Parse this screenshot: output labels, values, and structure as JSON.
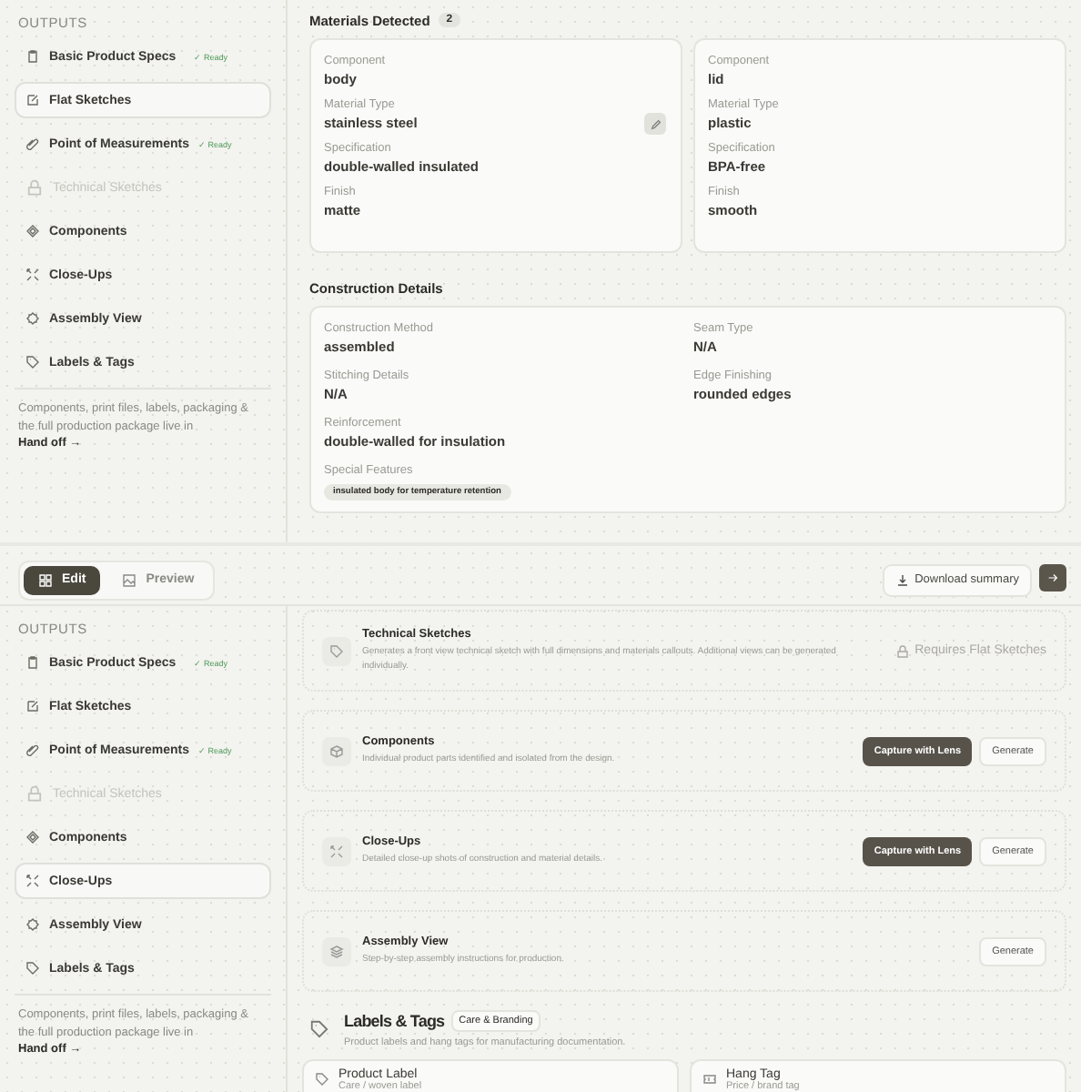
{
  "top_view": {
    "sidebar": {
      "heading": "OUTPUTS",
      "items": [
        {
          "label": "Basic Product Specs",
          "badge": "✓ Ready",
          "selected": false,
          "disabled": false
        },
        {
          "label": "Flat Sketches",
          "selected": true,
          "disabled": false
        },
        {
          "label": "Point of Measurements",
          "badge": "✓ Ready",
          "selected": false,
          "disabled": false
        },
        {
          "label": "Technical Sketches",
          "selected": false,
          "disabled": true
        },
        {
          "label": "Components",
          "selected": false,
          "disabled": false
        },
        {
          "label": "Close-Ups",
          "selected": false,
          "disabled": false
        },
        {
          "label": "Assembly View",
          "selected": false,
          "disabled": false
        },
        {
          "label": "Labels & Tags",
          "selected": false,
          "disabled": false
        }
      ],
      "note": "Components, print files, labels, packaging & the full production package live in",
      "link": "Hand off →"
    },
    "materials": {
      "title": "Materials Detected",
      "count": "2",
      "cards": [
        {
          "editable": true,
          "fields": [
            {
              "label": "Component",
              "value": "body"
            },
            {
              "label": "Material Type",
              "value": "stainless steel"
            },
            {
              "label": "Specification",
              "value": "double-walled insulated"
            },
            {
              "label": "Finish",
              "value": "matte"
            }
          ]
        },
        {
          "editable": false,
          "fields": [
            {
              "label": "Component",
              "value": "lid"
            },
            {
              "label": "Material Type",
              "value": "plastic"
            },
            {
              "label": "Specification",
              "value": "BPA-free"
            },
            {
              "label": "Finish",
              "value": "smooth"
            }
          ]
        }
      ]
    },
    "construction": {
      "title": "Construction Details",
      "fields": [
        {
          "label": "Construction Method",
          "value": "assembled"
        },
        {
          "label": "Seam Type",
          "value": "N/A"
        },
        {
          "label": "Stitching Details",
          "value": "N/A"
        },
        {
          "label": "Edge Finishing",
          "value": "rounded edges"
        },
        {
          "label": "Reinforcement",
          "value": "double-walled for insulation"
        }
      ],
      "features_label": "Special Features",
      "features": [
        "insulated body for temperature retention"
      ]
    }
  },
  "bottom_view": {
    "tabs": [
      {
        "label": "Edit",
        "selected": true
      },
      {
        "label": "Preview",
        "selected": false
      }
    ],
    "download_button": "Download summary",
    "sidebar": {
      "heading": "OUTPUTS",
      "items": [
        {
          "label": "Basic Product Specs",
          "badge": "✓ Ready",
          "selected": false,
          "disabled": false
        },
        {
          "label": "Flat Sketches",
          "selected": false,
          "disabled": false
        },
        {
          "label": "Point of Measurements",
          "badge": "✓ Ready",
          "selected": false,
          "disabled": false
        },
        {
          "label": "Technical Sketches",
          "selected": false,
          "disabled": true
        },
        {
          "label": "Components",
          "selected": false,
          "disabled": false
        },
        {
          "label": "Close-Ups",
          "selected": true,
          "disabled": false
        },
        {
          "label": "Assembly View",
          "selected": false,
          "disabled": false
        },
        {
          "label": "Labels & Tags",
          "selected": false,
          "disabled": false
        }
      ],
      "note": "Components, print files, labels, packaging & the full production package live in",
      "link": "Hand off →"
    },
    "outputs": [
      {
        "kind": "locked",
        "title": "Technical Sketches",
        "description": "Generates a front view technical sketch with full dimensions and materials callouts. Additional views can be generated individually.",
        "requirement": "Requires Flat Sketches"
      },
      {
        "kind": "actions",
        "title": "Components",
        "description": "Individual product parts identified and isolated from the design.",
        "buttons": [
          "Capture with Lens",
          "Generate"
        ]
      },
      {
        "kind": "actions",
        "title": "Close-Ups",
        "description": "Detailed close-up shots of construction and material details.",
        "buttons": [
          "Capture with Lens",
          "Generate"
        ]
      },
      {
        "kind": "actions",
        "title": "Assembly View",
        "description": "Step-by-step assembly instructions for production.",
        "buttons": [
          "Generate"
        ]
      }
    ],
    "labels": {
      "title": "Labels & Tags",
      "badge": "Care & Branding",
      "description": "Product labels and hang tags for manufacturing documentation.",
      "cards": [
        {
          "title": "Product Label",
          "subtitle": "Care / woven label"
        },
        {
          "title": "Hang Tag",
          "subtitle": "Price / brand tag"
        }
      ]
    }
  }
}
